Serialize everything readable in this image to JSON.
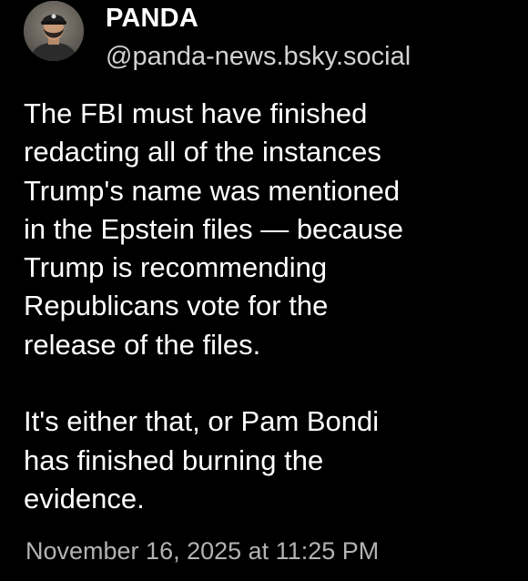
{
  "author": {
    "display_name": "PANDA",
    "handle": "@panda-news.bsky.social",
    "avatar_icon": "user-avatar-photo"
  },
  "post": {
    "paragraph_1": [
      "The FBI must have finished",
      "redacting all of the instances",
      "Trump's name was mentioned",
      "in the Epstein files — because",
      "Trump is recommending",
      "Republicans vote for the",
      "release of the files."
    ],
    "paragraph_2": [
      "It's either that, or Pam Bondi",
      "has finished burning the",
      "evidence."
    ],
    "timestamp": "November 16, 2025 at 11:25 PM"
  },
  "colors": {
    "background": "#000000",
    "text_primary": "#ffffff",
    "text_handle": "#d2d2d2",
    "text_timestamp": "#b3b3b3"
  }
}
